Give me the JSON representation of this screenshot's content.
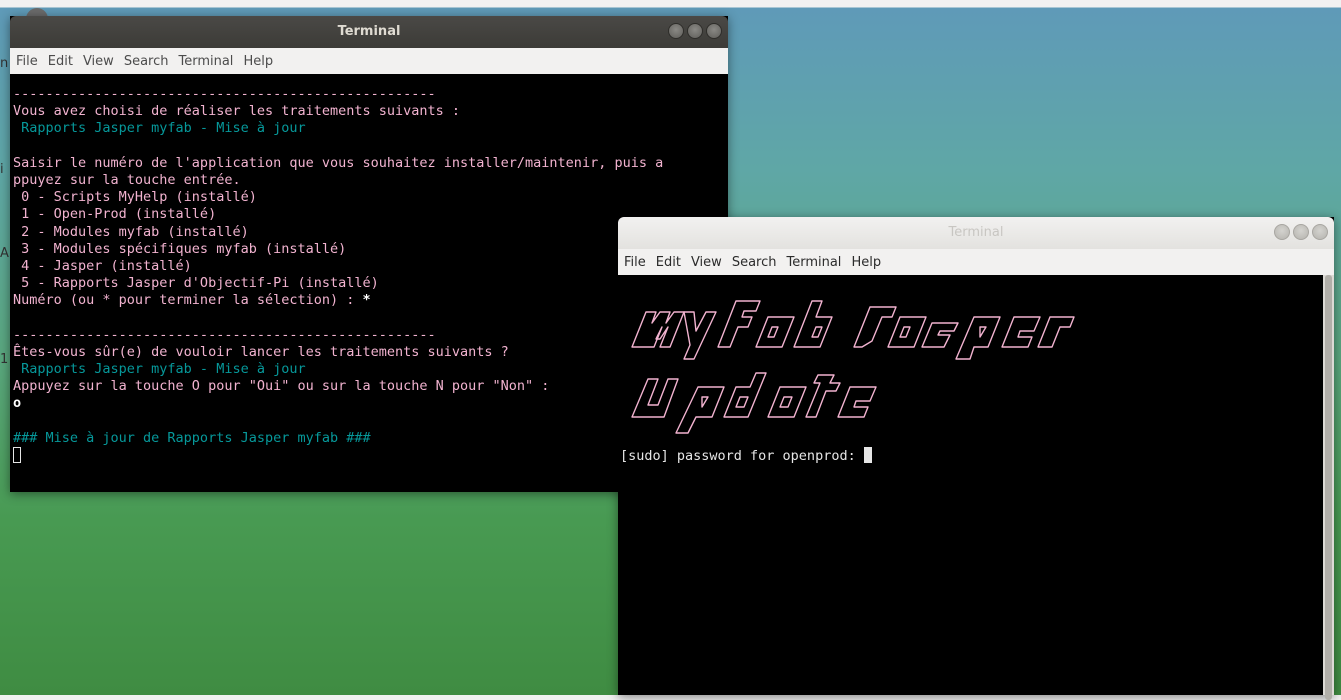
{
  "window1": {
    "title": "Terminal",
    "menu": [
      "File",
      "Edit",
      "View",
      "Search",
      "Terminal",
      "Help"
    ],
    "lines": [
      {
        "text": "----------------------------------------------------",
        "cls": "pink"
      },
      {
        "text": "Vous avez choisi de réaliser les traitements suivants :",
        "cls": "pink"
      },
      {
        "text": " Rapports Jasper myfab - Mise à jour",
        "cls": "teal"
      },
      {
        "text": "",
        "cls": ""
      },
      {
        "text": "Saisir le numéro de l'application que vous souhaitez installer/maintenir, puis a",
        "cls": "pink"
      },
      {
        "text": "ppuyez sur la touche entrée.",
        "cls": "pink"
      },
      {
        "text": " 0 - Scripts MyHelp (installé)",
        "cls": "pink"
      },
      {
        "text": " 1 - Open-Prod (installé)",
        "cls": "pink"
      },
      {
        "text": " 2 - Modules myfab (installé)",
        "cls": "pink"
      },
      {
        "text": " 3 - Modules spécifiques myfab (installé)",
        "cls": "pink"
      },
      {
        "text": " 4 - Jasper (installé)",
        "cls": "pink"
      },
      {
        "text": " 5 - Rapports Jasper d'Objectif-Pi (installé)",
        "cls": "pink"
      },
      {
        "text": "Numéro (ou * pour terminer la sélection) : ",
        "cls": "pink",
        "suffix": "*"
      },
      {
        "text": "",
        "cls": ""
      },
      {
        "text": "----------------------------------------------------",
        "cls": "pink"
      },
      {
        "text": "Êtes-vous sûr(e) de vouloir lancer les traitements suivants ?",
        "cls": "pink"
      },
      {
        "text": " Rapports Jasper myfab - Mise à jour",
        "cls": "teal"
      },
      {
        "text": "Appuyez sur la touche O pour \"Oui\" ou sur la touche N pour \"Non\" :",
        "cls": "pink"
      },
      {
        "text": "",
        "cls": "",
        "suffix": "o"
      },
      {
        "text": "",
        "cls": ""
      },
      {
        "text": "### Mise à jour de Rapports Jasper myfab ###",
        "cls": "teal"
      },
      {
        "text": "",
        "cls": ""
      }
    ]
  },
  "window2": {
    "title": "Terminal",
    "menu": [
      "File",
      "Edit",
      "View",
      "Search",
      "Terminal",
      "Help"
    ],
    "banner_text": "myfab Jasper Update",
    "prompt": "[sudo] password for openprod: "
  },
  "colors": {
    "teal": "#06989a",
    "pink": "#f2b3d0"
  }
}
